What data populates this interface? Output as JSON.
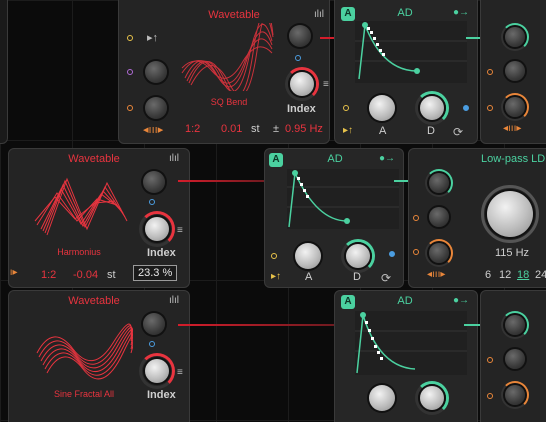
{
  "colors": {
    "wavetable": "#e8343f",
    "envelope": "#4bd1a0",
    "background": "#0b0b0b",
    "panel": "#242424"
  },
  "row1": {
    "wavetable": {
      "title": "Wavetable",
      "wave_name": "SQ Bend",
      "index_label": "Index",
      "ratio": "1:2",
      "semitone": "0.01",
      "semitone_unit": "st",
      "fine_prefix": "±",
      "fine_value": "0.95 Hz"
    },
    "ad": {
      "title": "AD",
      "a_label": "A",
      "d_label": "D",
      "badge": "A"
    }
  },
  "row2": {
    "wavetable": {
      "title": "Wavetable",
      "wave_name": "Harmonius",
      "index_label": "Index",
      "ratio": "1:2",
      "semitone": "-0.04",
      "semitone_unit": "st",
      "index_value": "23.3 %"
    },
    "ad": {
      "title": "AD",
      "a_label": "A",
      "d_label": "D",
      "badge": "A"
    },
    "filter": {
      "title": "Low-pass LD",
      "cutoff": "115 Hz",
      "slopes": [
        "6",
        "12",
        "18",
        "24"
      ],
      "selected_slope": "18"
    }
  },
  "row3": {
    "wavetable": {
      "title": "Wavetable",
      "wave_name": "Sine Fractal All",
      "index_label": "Index"
    },
    "ad": {
      "title": "AD",
      "badge": "A"
    }
  },
  "icons": [
    "bars-icon",
    "arrow-right-icon",
    "modulator-arrow-icon",
    "piano-icon",
    "loop-icon",
    "list-icon"
  ]
}
